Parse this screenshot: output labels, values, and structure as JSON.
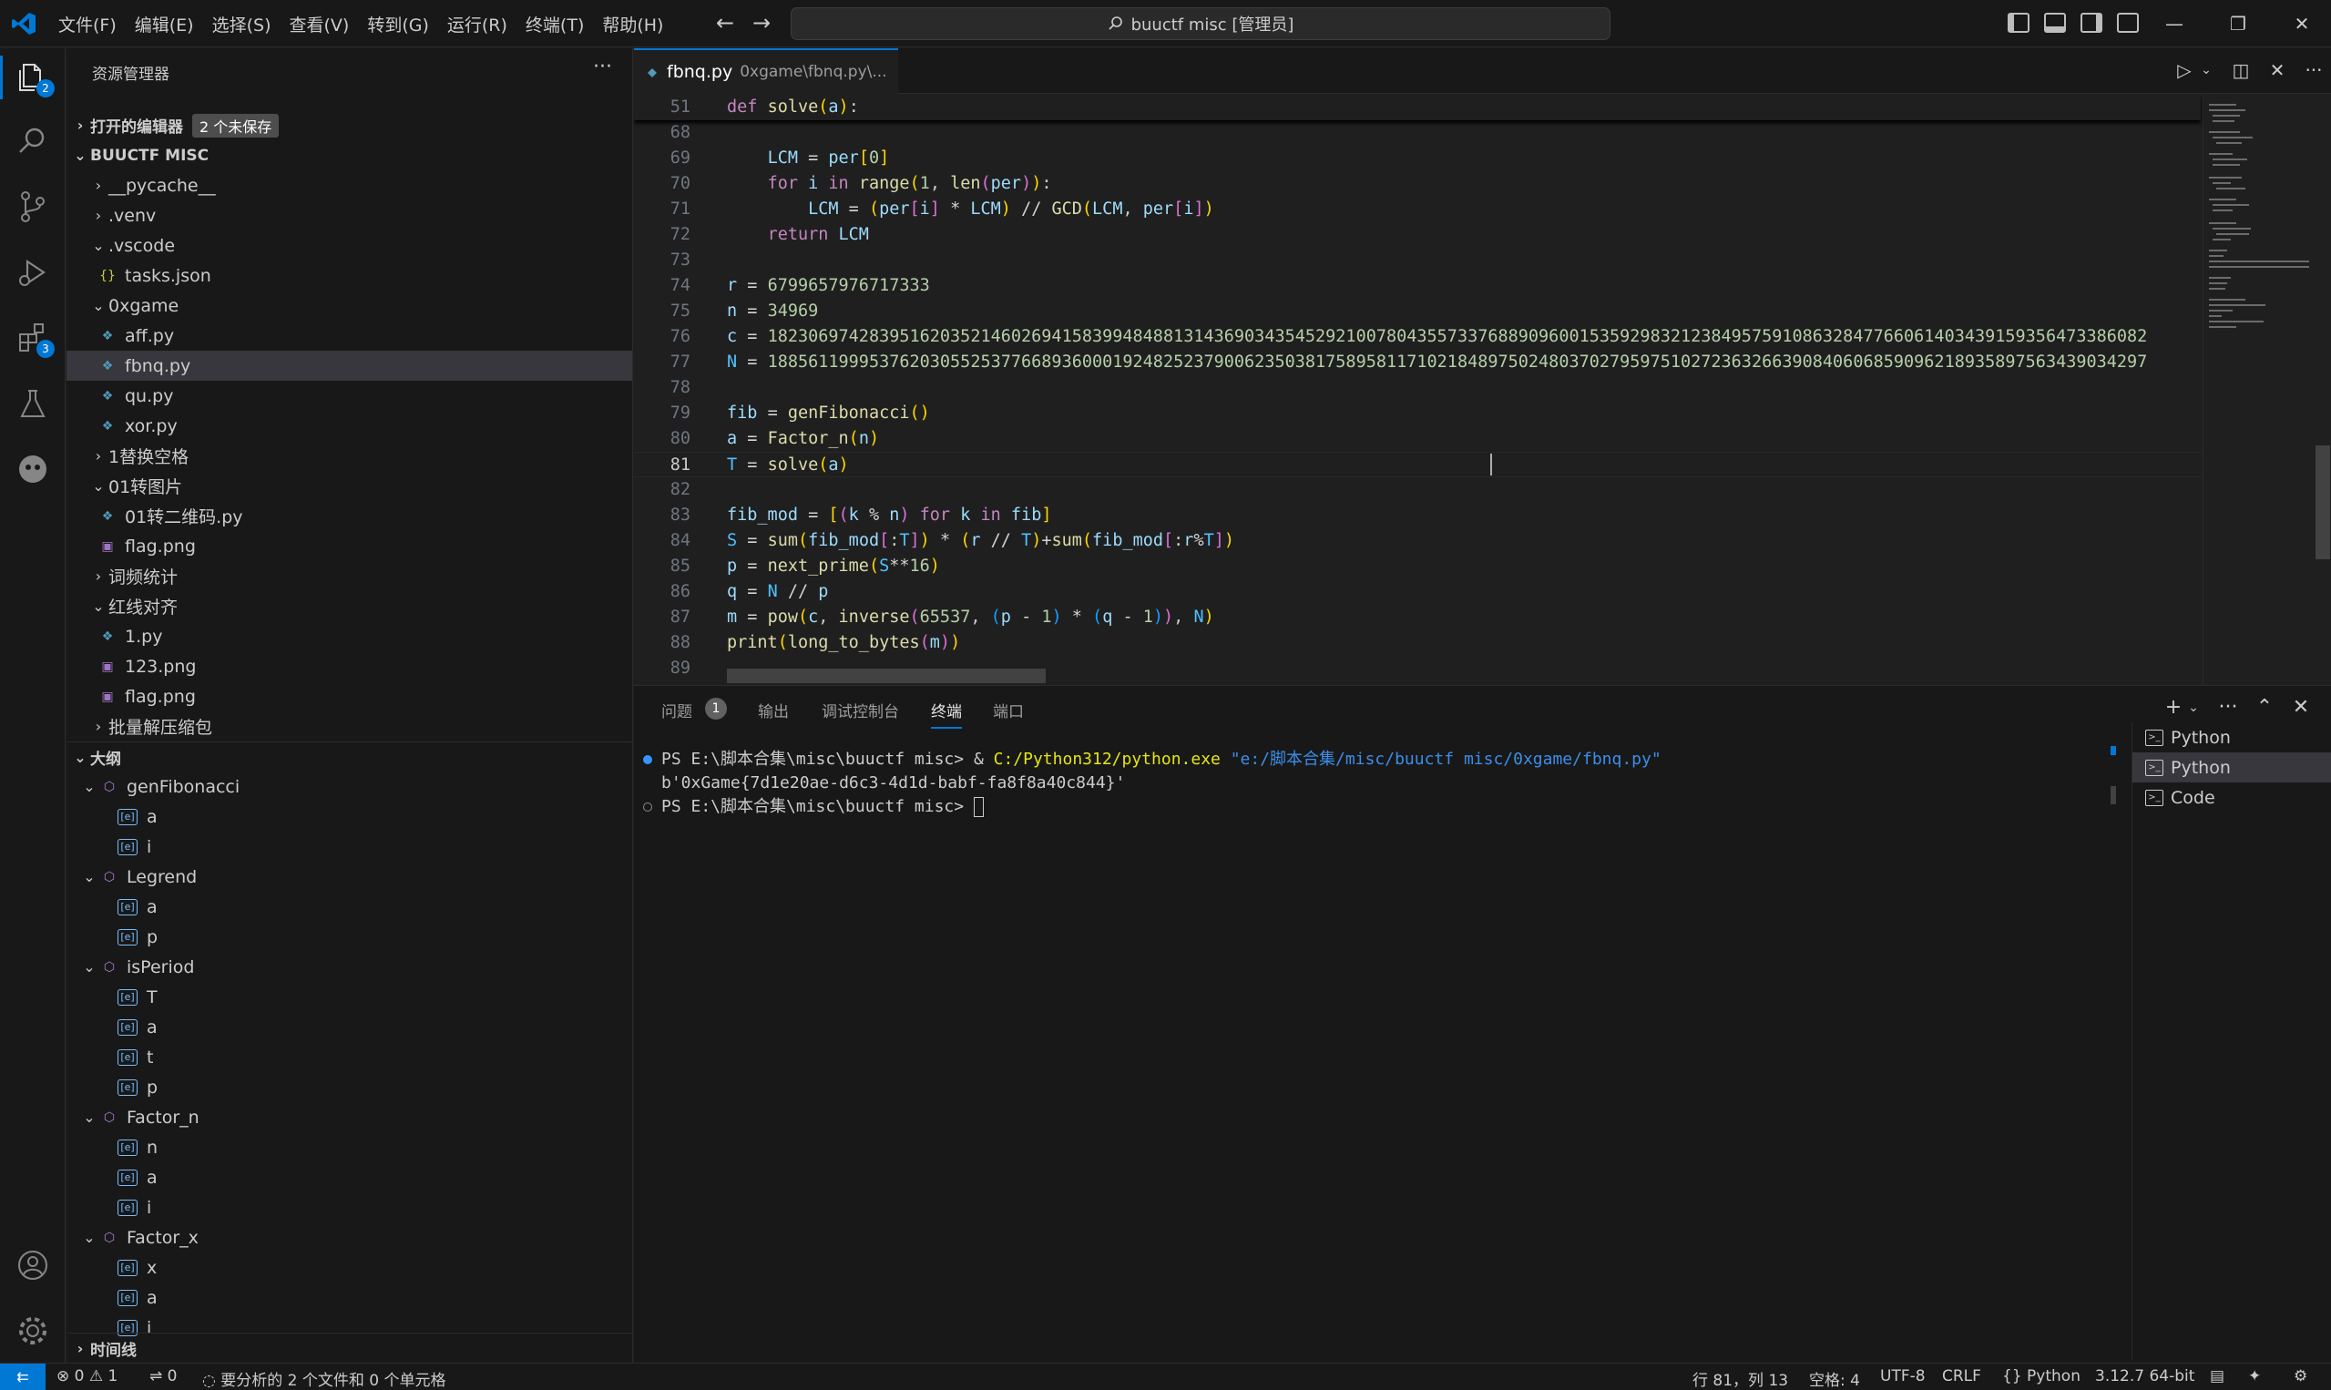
{
  "titlebar": {
    "menu": [
      "文件(F)",
      "编辑(E)",
      "选择(S)",
      "查看(V)",
      "转到(G)",
      "运行(R)",
      "终端(T)",
      "帮助(H)"
    ],
    "search_text": "buuctf misc [管理员]"
  },
  "activity": {
    "explorer_badge": "2",
    "extensions_badge": "3"
  },
  "sidebar": {
    "title": "资源管理器",
    "open_editors": "打开的编辑器",
    "unsaved": "2 个未保存",
    "workspace": "BUUCTF MISC",
    "files": [
      "__pycache__",
      ".venv",
      ".vscode",
      "tasks.json",
      "0xgame",
      "aff.py",
      "fbnq.py",
      "qu.py",
      "xor.py",
      "1替换空格",
      "01转图片",
      "01转二维码.py",
      "flag.png",
      "词频统计",
      "红线对齐",
      "1.py",
      "123.png",
      "flag.png",
      "批量解压缩包"
    ],
    "outline_title": "大纲",
    "outline": [
      "genFibonacci",
      "a",
      "i",
      "Legrend",
      "a",
      "p",
      "isPeriod",
      "T",
      "a",
      "t",
      "p",
      "Factor_n",
      "n",
      "a",
      "i",
      "Factor_x",
      "x",
      "a",
      "i"
    ],
    "timeline": "时间线"
  },
  "editor": {
    "tab_name": "fbnq.py",
    "tab_desc": "0xgame\\fbnq.py\\...",
    "sticky_ln": "51",
    "lines": [
      {
        "ln": "68",
        "text": ""
      },
      {
        "ln": "69",
        "text": "    LCM = per[0]"
      },
      {
        "ln": "70",
        "text": "    for i in range(1, len(per)):"
      },
      {
        "ln": "71",
        "text": "        LCM = (per[i] * LCM) // GCD(LCM, per[i])"
      },
      {
        "ln": "72",
        "text": "    return LCM"
      },
      {
        "ln": "73",
        "text": ""
      },
      {
        "ln": "74",
        "text": "r = 6799657976717333"
      },
      {
        "ln": "75",
        "text": "n = 34969"
      },
      {
        "ln": "76",
        "text": "c = 1823069742839516203521460269415839948488131436903435452921007804355733768890960015359298321238495759108632847766061403439159356473386082"
      },
      {
        "ln": "77",
        "text": "N = 1885611999537620305525377668936000192482523790062350381758958117102184897502480370279597510272363266390840606859096218935897563439034297"
      },
      {
        "ln": "78",
        "text": ""
      },
      {
        "ln": "79",
        "text": "fib = genFibonacci()"
      },
      {
        "ln": "80",
        "text": "a = Factor_n(n)"
      },
      {
        "ln": "81",
        "text": "T = solve(a)"
      },
      {
        "ln": "82",
        "text": ""
      },
      {
        "ln": "83",
        "text": "fib_mod = [(k % n) for k in fib]"
      },
      {
        "ln": "84",
        "text": "S = sum(fib_mod[:T]) * (r // T)+sum(fib_mod[:r%T])"
      },
      {
        "ln": "85",
        "text": "p = next_prime(S**16)"
      },
      {
        "ln": "86",
        "text": "q = N // p"
      },
      {
        "ln": "87",
        "text": "m = pow(c, inverse(65537, (p - 1) * (q - 1)), N)"
      },
      {
        "ln": "88",
        "text": "print(long_to_bytes(m))"
      },
      {
        "ln": "89",
        "text": ""
      }
    ]
  },
  "panel": {
    "tabs": [
      "问题",
      "输出",
      "调试控制台",
      "终端",
      "端口"
    ],
    "problems_count": "1",
    "terminal": {
      "prompt1": "PS E:\\脚本合集\\misc\\buuctf misc> ",
      "amp": "& ",
      "exe": "C:/Python312/python.exe",
      "script": " \"e:/脚本合集/misc/buuctf misc/0xgame/fbnq.py\"",
      "output": "b'0xGame{7d1e20ae-d6c3-4d1d-babf-fa8f8a40c844}'",
      "prompt2": "PS E:\\脚本合集\\misc\\buuctf misc> "
    },
    "terminals": [
      "Python",
      "Python",
      "Code"
    ]
  },
  "status": {
    "errors": "0",
    "warnings": "1",
    "ports": "0",
    "analysis": "要分析的 2 个文件和 0 个单元格",
    "position": "行 81，列 13",
    "spaces": "空格: 4",
    "encoding": "UTF-8",
    "eol": "CRLF",
    "language": "Python",
    "interpreter": "3.12.7 64-bit"
  }
}
